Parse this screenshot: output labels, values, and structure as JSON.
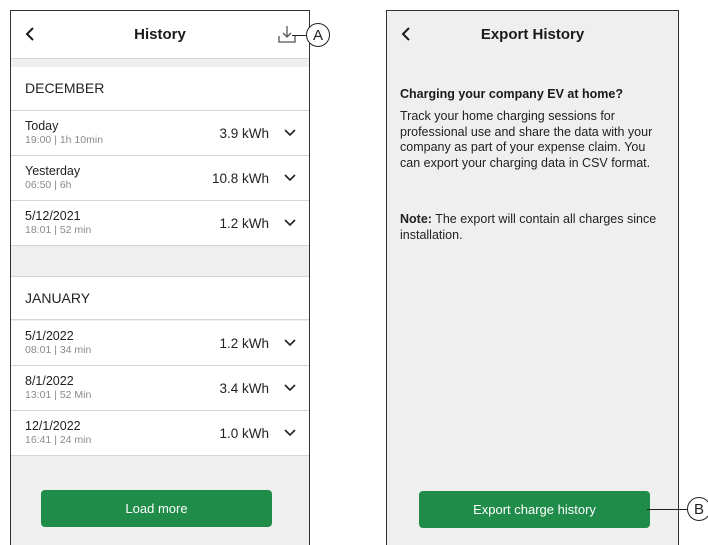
{
  "history_screen": {
    "title": "History",
    "sections": [
      {
        "month": "DECEMBER",
        "entries": [
          {
            "date": "Today",
            "detail": "19:00 | 1h 10min",
            "energy": "3.9 kWh"
          },
          {
            "date": "Yesterday",
            "detail": "06:50 | 6h",
            "energy": "10.8 kWh"
          },
          {
            "date": "5/12/2021",
            "detail": "18:01 | 52 min",
            "energy": "1.2 kWh"
          }
        ]
      },
      {
        "month": "JANUARY",
        "entries": [
          {
            "date": "5/1/2022",
            "detail": "08:01 | 34 min",
            "energy": "1.2 kWh"
          },
          {
            "date": "8/1/2022",
            "detail": "13:01 | 52 Min",
            "energy": "3.4 kWh"
          },
          {
            "date": "12/1/2022",
            "detail": "16:41 | 24 min",
            "energy": "1.0 kWh"
          }
        ]
      }
    ],
    "load_more_label": "Load more"
  },
  "export_screen": {
    "title": "Export History",
    "heading": "Charging your company EV at home?",
    "body": "Track your home charging sessions for professional use and share the data with your company as part of your expense claim. You can export your charging data in CSV format.",
    "note_label": "Note:",
    "note_text": " The export will contain all charges since installation.",
    "export_button_label": "Export charge history"
  },
  "callouts": {
    "a": "A",
    "b": "B"
  },
  "colors": {
    "accent_green": "#1f8c4a",
    "screen_background": "#efefef",
    "divider": "#d6d6d6"
  },
  "icons": {
    "back": "chevron-left-icon",
    "download": "download-icon",
    "expand": "chevron-down-icon"
  }
}
